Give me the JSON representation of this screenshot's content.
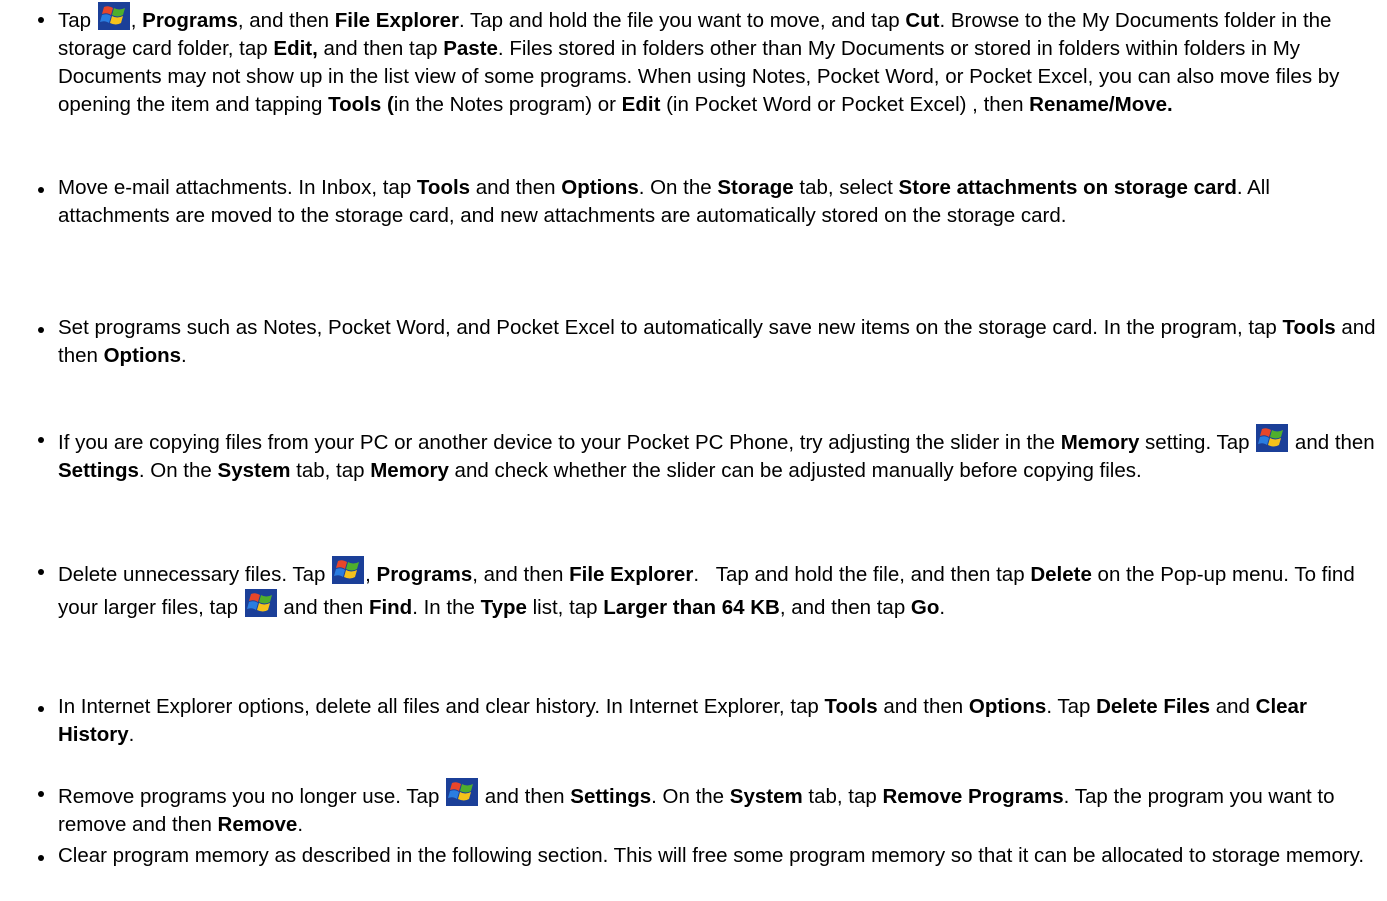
{
  "bullets": [
    {
      "segments": [
        {
          "t": "Tap ",
          "b": false
        },
        {
          "icon": "windows-start-icon"
        },
        {
          "t": ", ",
          "b": false
        },
        {
          "t": "Programs",
          "b": true
        },
        {
          "t": ", and then ",
          "b": false
        },
        {
          "t": "File Explorer",
          "b": true
        },
        {
          "t": ". Tap and hold the file you want to move, and tap ",
          "b": false
        },
        {
          "t": "Cut",
          "b": true
        },
        {
          "t": ". Browse to the My Documents folder in the storage card folder, tap ",
          "b": false
        },
        {
          "t": "Edit,",
          "b": true
        },
        {
          "t": " and then tap ",
          "b": false
        },
        {
          "t": "Paste",
          "b": true
        },
        {
          "t": ". Files stored in folders other than My Documents or stored in folders within folders in My Documents may not show up in the list view of some programs. When using Notes, Pocket Word, or Pocket Excel, you can also move files by opening the item and tapping ",
          "b": false
        },
        {
          "t": "Tools (",
          "b": true
        },
        {
          "t": "in the Notes program) or ",
          "b": false
        },
        {
          "t": "Edit",
          "b": true
        },
        {
          "t": " (in Pocket Word or Pocket Excel) , then ",
          "b": false
        },
        {
          "t": "Rename/Move.",
          "b": true
        }
      ]
    },
    {
      "segments": [
        {
          "t": "Move e-mail attachments. In Inbox, tap ",
          "b": false
        },
        {
          "t": "Tools",
          "b": true
        },
        {
          "t": " and then ",
          "b": false
        },
        {
          "t": "Options",
          "b": true
        },
        {
          "t": ". On the ",
          "b": false
        },
        {
          "t": "Storage",
          "b": true
        },
        {
          "t": " tab, select ",
          "b": false
        },
        {
          "t": "Store attachments on storage card",
          "b": true
        },
        {
          "t": ". All attachments are moved to the storage card, and new attachments are automatically stored on the storage card.",
          "b": false
        }
      ]
    },
    {
      "segments": [
        {
          "t": "Set programs such as Notes, Pocket Word, and Pocket Excel to automatically save new items on the storage card. In the program, tap ",
          "b": false
        },
        {
          "t": "Tools",
          "b": true
        },
        {
          "t": " and then ",
          "b": false
        },
        {
          "t": "Options",
          "b": true
        },
        {
          "t": ".",
          "b": false
        }
      ]
    },
    {
      "segments": [
        {
          "t": "If you are copying files from your PC or another device to your Pocket PC Phone, try adjusting the slider in the ",
          "b": false
        },
        {
          "t": "Memory",
          "b": true
        },
        {
          "t": " setting. Tap ",
          "b": false
        },
        {
          "icon": "windows-start-icon"
        },
        {
          "t": " and then ",
          "b": false
        },
        {
          "t": "Settings",
          "b": true
        },
        {
          "t": ". On the ",
          "b": false
        },
        {
          "t": "System",
          "b": true
        },
        {
          "t": " tab, tap ",
          "b": false
        },
        {
          "t": "Memory",
          "b": true
        },
        {
          "t": " and check whether the slider can be adjusted manually before copying files.",
          "b": false
        }
      ]
    },
    {
      "segments": [
        {
          "t": "Delete unnecessary files. Tap ",
          "b": false
        },
        {
          "icon": "windows-start-icon"
        },
        {
          "t": ", ",
          "b": false
        },
        {
          "t": "Programs",
          "b": true
        },
        {
          "t": ", and then ",
          "b": false
        },
        {
          "t": "File Explorer",
          "b": true
        },
        {
          "t": ".   Tap and hold the file, and then tap ",
          "b": false
        },
        {
          "t": "Delete",
          "b": true
        },
        {
          "t": " on the Pop-up menu. To find your larger files, tap ",
          "b": false
        },
        {
          "icon": "windows-start-icon"
        },
        {
          "t": " and then ",
          "b": false
        },
        {
          "t": "Find",
          "b": true
        },
        {
          "t": ". In the ",
          "b": false
        },
        {
          "t": "Type",
          "b": true
        },
        {
          "t": " list, tap ",
          "b": false
        },
        {
          "t": "Larger than 64 KB",
          "b": true
        },
        {
          "t": ", and then tap ",
          "b": false
        },
        {
          "t": "Go",
          "b": true
        },
        {
          "t": ".",
          "b": false
        }
      ]
    },
    {
      "segments": [
        {
          "t": "In Internet Explorer options, delete all files and clear history. In Internet Explorer, tap ",
          "b": false
        },
        {
          "t": "Tools",
          "b": true
        },
        {
          "t": " and then ",
          "b": false
        },
        {
          "t": "Options",
          "b": true
        },
        {
          "t": ". Tap ",
          "b": false
        },
        {
          "t": "Delete Files",
          "b": true
        },
        {
          "t": " and ",
          "b": false
        },
        {
          "t": "Clear History",
          "b": true
        },
        {
          "t": ".",
          "b": false
        }
      ]
    },
    {
      "segments": [
        {
          "t": "Remove programs you no longer use. Tap ",
          "b": false
        },
        {
          "icon": "windows-start-icon"
        },
        {
          "t": " and then ",
          "b": false
        },
        {
          "t": "Settings",
          "b": true
        },
        {
          "t": ". On the ",
          "b": false
        },
        {
          "t": "System",
          "b": true
        },
        {
          "t": " tab, tap ",
          "b": false
        },
        {
          "t": "Remove Programs",
          "b": true
        },
        {
          "t": ". Tap the program you want to remove and then ",
          "b": false
        },
        {
          "t": "Remove",
          "b": true
        },
        {
          "t": ".",
          "b": false
        }
      ]
    },
    {
      "segments": [
        {
          "t": "Clear program memory as described in the following section. This will free some program memory so that it can be allocated to storage memory.",
          "b": false
        }
      ]
    }
  ],
  "colors": {
    "text": "#000000",
    "background": "#ffffff",
    "icon_blue": "#1b3f98"
  }
}
